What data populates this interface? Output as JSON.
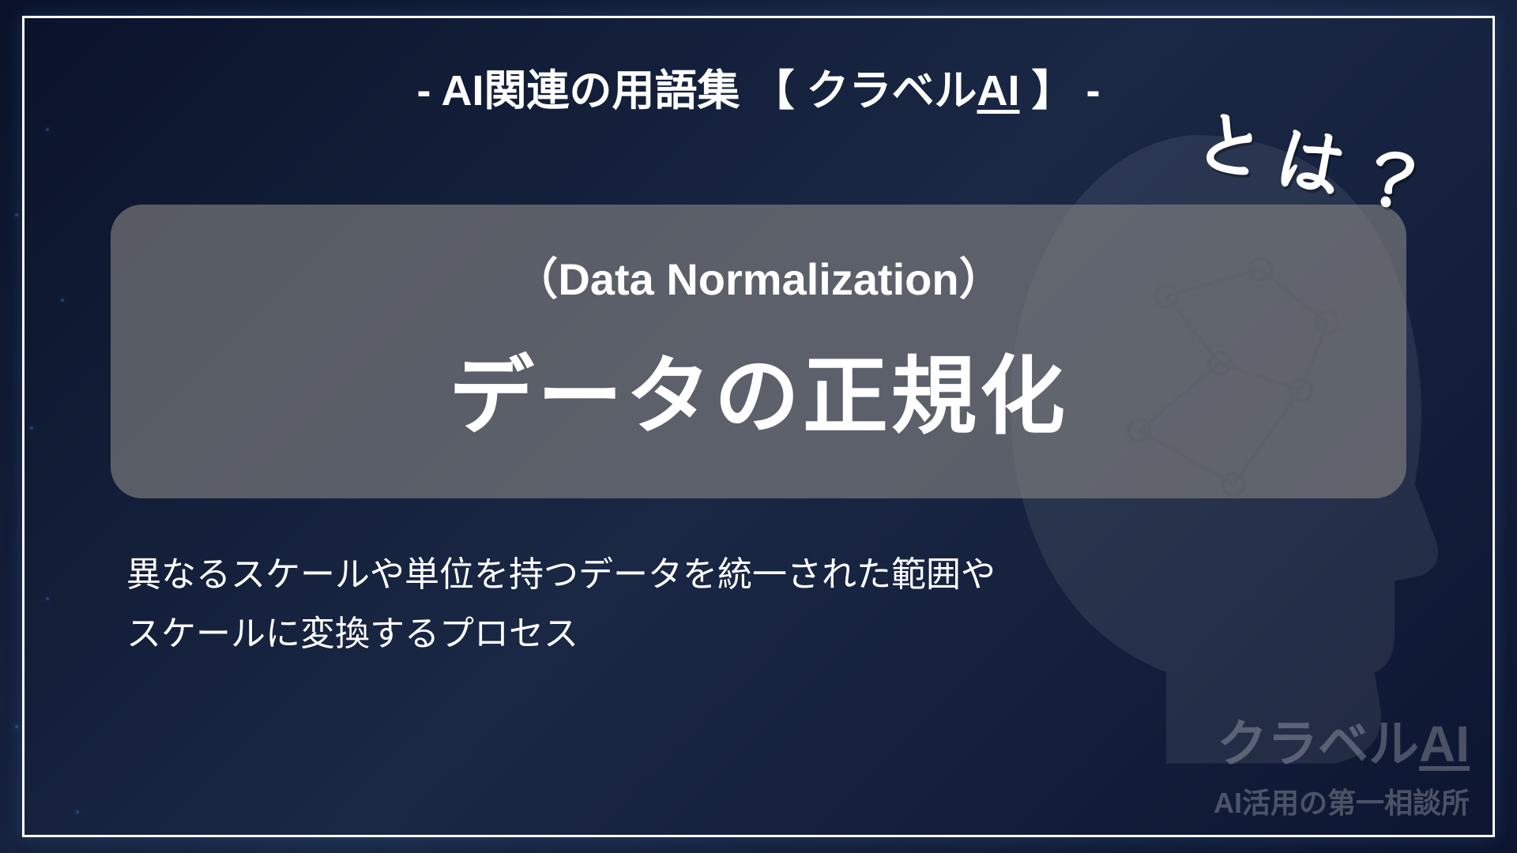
{
  "header": {
    "prefix": "- AI関連の用語集 【 クラベル",
    "ai_text": "AI",
    "suffix": " 】 -"
  },
  "term": {
    "english": "（Data Normalization）",
    "japanese": "データの正規化",
    "towa": "とは？"
  },
  "description": {
    "line1": "異なるスケールや単位を持つデータを統一された範囲や",
    "line2": "スケールに変換するプロセス"
  },
  "watermark": {
    "brand_prefix": "クラベル",
    "brand_ai": "AI",
    "tagline": "AI活用の第一相談所"
  }
}
